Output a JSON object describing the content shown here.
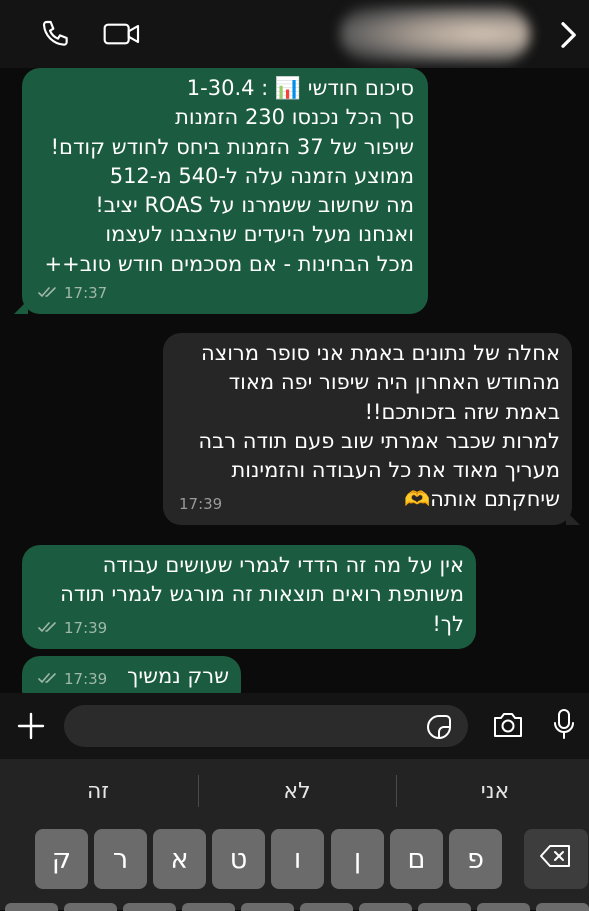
{
  "header": {
    "call_icon": "phone-icon",
    "video_icon": "video-icon",
    "contact_name": "",
    "next_icon": "chevron-right-icon"
  },
  "messages": [
    {
      "direction": "incoming",
      "text": "סיכום חודשי 📊 : 1-30.4\nסך הכל נכנסו 230 הזמנות\nשיפור של 37 הזמנות ביחס לחודש קודם!\nממוצע הזמנה עלה ל-540 מ-512\nמה שחשוב ששמרנו על ROAS יציב!\nואנחנו מעל היעדים שהצבנו לעצמו\nמכל הבחינות - אם מסכמים חודש טוב++",
      "time": "17:37",
      "status_icon": "double-check-icon"
    },
    {
      "direction": "outgoing",
      "text": "אחלה של נתונים באמת אני סופר מרוצה\nמהחודש האחרון היה שיפור יפה מאוד\nבאמת שזה בזכותכם!!\nלמרות שכבר אמרתי שוב פעם תודה רבה\nמעריך מאוד את כל העבודה והזמינות\nשיחקתם אותה🫶",
      "time": "17:39"
    },
    {
      "direction": "incoming",
      "text": "אין על מה זה הדדי לגמרי שעושים עבודה\nמשותפת רואים תוצאות זה מורגש לגמרי תודה\nלך!",
      "time": "17:39",
      "status_icon": "double-check-icon"
    },
    {
      "direction": "incoming",
      "text": "שרק נמשיך",
      "time": "17:39",
      "status_icon": "double-check-icon"
    }
  ],
  "composer": {
    "value": "",
    "placeholder": "",
    "add_icon": "plus-icon",
    "sticker_icon": "sticker-icon",
    "camera_icon": "camera-icon",
    "mic_icon": "microphone-icon"
  },
  "keyboard": {
    "suggestions": [
      "זה",
      "לא",
      "אני"
    ],
    "keys": [
      "ק",
      "ר",
      "א",
      "ט",
      "ו",
      "ן",
      "ם",
      "פ"
    ],
    "backspace_icon": "backspace-icon"
  }
}
